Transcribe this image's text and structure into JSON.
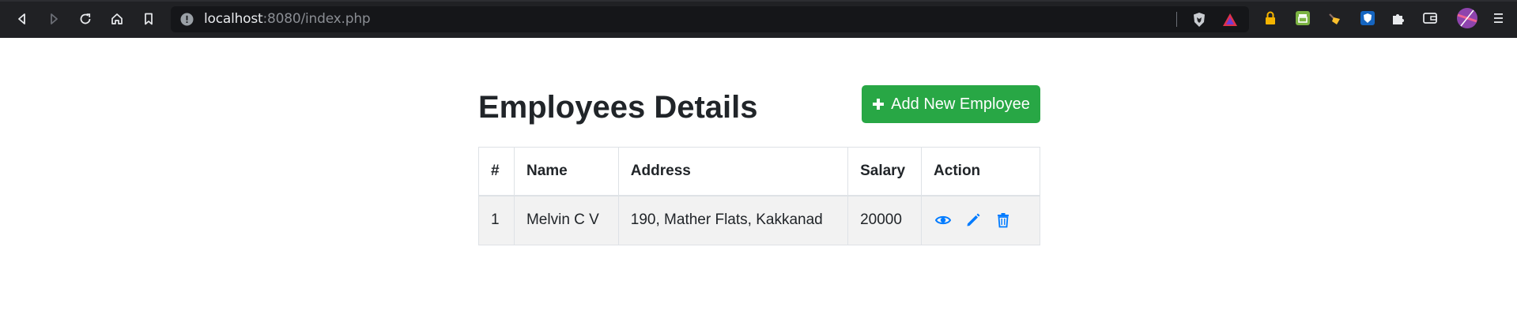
{
  "browser": {
    "url_host": "localhost",
    "url_rest": ":8080/index.php",
    "icons": [
      "back-icon",
      "forward-icon",
      "reload-icon",
      "home-icon",
      "bookmark-icon",
      "site-info-icon",
      "brave-shields-icon",
      "brave-rewards-icon",
      "lock-extension-icon",
      "store-extension-icon",
      "broom-extension-icon",
      "shield-extension-icon",
      "extensions-puzzle-icon",
      "wallet-icon",
      "profile-avatar-icon",
      "menu-icon"
    ]
  },
  "page": {
    "title": "Employees Details",
    "add_button_label": "Add New Employee",
    "accent_color": "#28a745",
    "action_color": "#007bff"
  },
  "table": {
    "headers": [
      "#",
      "Name",
      "Address",
      "Salary",
      "Action"
    ],
    "rows": [
      {
        "id": "1",
        "name": "Melvin C V",
        "address": "190, Mather Flats, Kakkanad",
        "salary": "20000",
        "actions": [
          "view-icon",
          "edit-icon",
          "delete-icon"
        ]
      }
    ]
  }
}
